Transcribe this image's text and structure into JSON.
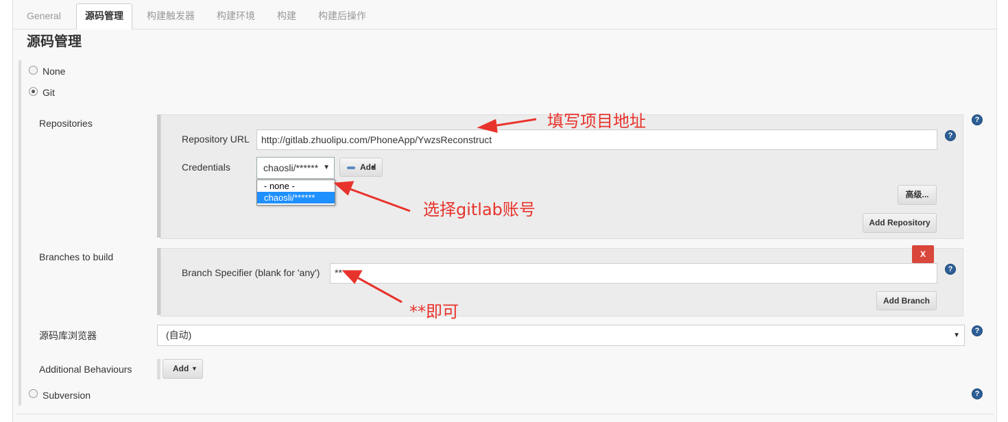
{
  "tabs": [
    {
      "label": "General",
      "active": false
    },
    {
      "label": "源码管理",
      "active": true
    },
    {
      "label": "构建触发器",
      "active": false
    },
    {
      "label": "构建环境",
      "active": false
    },
    {
      "label": "构建",
      "active": false
    },
    {
      "label": "构建后操作",
      "active": false
    }
  ],
  "section_title": "源码管理",
  "scm": {
    "none_label": "None",
    "git_label": "Git",
    "svn_label": "Subversion",
    "selected": "Git"
  },
  "repositories": {
    "label": "Repositories",
    "url_label": "Repository URL",
    "url_value": "http://gitlab.zhuolipu.com/PhoneApp/YwzsReconstruct",
    "credentials_label": "Credentials",
    "credentials_value": "chaosli/******",
    "credentials_options": [
      "- none -",
      "chaosli/******"
    ],
    "credentials_selected_option": "chaosli/******",
    "add_label": "Add",
    "advanced_label": "高级...",
    "add_repository_label": "Add Repository"
  },
  "branches": {
    "label": "Branches to build",
    "specifier_label": "Branch Specifier (blank for 'any')",
    "specifier_value": "**",
    "delete_label": "X",
    "add_branch_label": "Add Branch"
  },
  "browser": {
    "label": "源码库浏览器",
    "value": "(自动)"
  },
  "behaviours": {
    "label": "Additional Behaviours",
    "add_label": "Add"
  },
  "annotations": {
    "url_note": "填写项目地址",
    "credentials_note": "选择gitlab账号",
    "branch_note": "**即可"
  },
  "colors": {
    "annotation": "#e8332c",
    "selected_option": "#1e90ff",
    "delete_button": "#d9463a",
    "help_icon": "#2d5f96"
  }
}
